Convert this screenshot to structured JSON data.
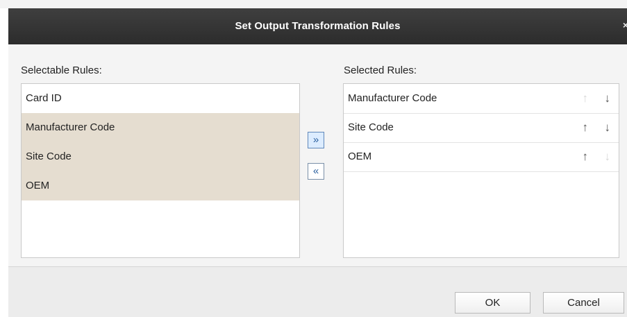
{
  "dialog": {
    "title": "Set Output Transformation Rules",
    "close_glyph": "×"
  },
  "selectable": {
    "label": "Selectable Rules:",
    "items": [
      "Card ID",
      "Manufacturer Code",
      "Site Code",
      "OEM"
    ]
  },
  "selected": {
    "label": "Selected Rules:",
    "items": [
      "Manufacturer Code",
      "Site Code",
      "OEM"
    ]
  },
  "controls": {
    "add_glyph": "»",
    "remove_glyph": "«",
    "up_glyph": "↑",
    "down_glyph": "↓"
  },
  "footer": {
    "ok_label": "OK",
    "cancel_label": "Cancel"
  },
  "colors": {
    "titlebar": "#333333",
    "selection": "#e5ddd0",
    "arrow_button_accent": "#2a5f9e"
  }
}
